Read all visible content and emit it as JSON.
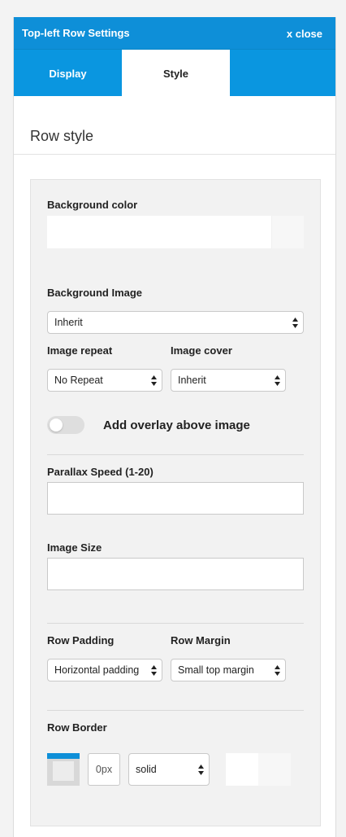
{
  "window": {
    "title": "Top-left Row Settings",
    "close_label": "x close"
  },
  "tabs": [
    {
      "label": "Display",
      "active": false
    },
    {
      "label": "Style",
      "active": true
    }
  ],
  "section": {
    "title": "Row style"
  },
  "background": {
    "color_label": "Background color",
    "image_label": "Background Image",
    "image_value": "Inherit",
    "repeat_label": "Image repeat",
    "repeat_value": "No Repeat",
    "cover_label": "Image cover",
    "cover_value": "Inherit"
  },
  "overlay": {
    "label": "Add overlay above image",
    "enabled": false
  },
  "parallax": {
    "label": "Parallax Speed (1-20)",
    "value": ""
  },
  "image_size": {
    "label": "Image Size",
    "value": ""
  },
  "spacing": {
    "padding_label": "Row Padding",
    "padding_value": "Horizontal padding",
    "margin_label": "Row Margin",
    "margin_value": "Small top margin"
  },
  "border": {
    "label": "Row Border",
    "width_value": "0px",
    "style_value": "solid"
  },
  "colors": {
    "accent": "#0e8fd8",
    "tab_bar": "#0a96e0",
    "panel_bg": "#f2f2f2"
  }
}
